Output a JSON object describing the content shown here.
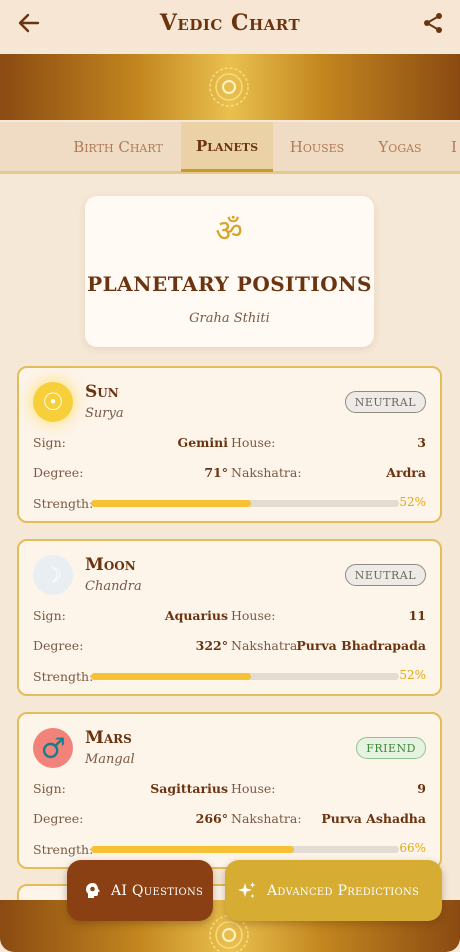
{
  "header": {
    "title": "Vedic Chart",
    "back_icon": "arrow-left-icon",
    "share_icon": "share-icon"
  },
  "tabs": [
    {
      "label": "Birth Chart",
      "active": false
    },
    {
      "label": "Planets",
      "active": true
    },
    {
      "label": "Houses",
      "active": false
    },
    {
      "label": "Yogas",
      "active": false
    },
    {
      "label": "I",
      "active": false
    }
  ],
  "hero": {
    "icon": "om-icon",
    "symbol": "ॐ",
    "title": "PLANETARY POSITIONS",
    "subtitle": "Graha Sthiti"
  },
  "labels": {
    "sign": "Sign:",
    "house": "House:",
    "degree": "Degree:",
    "nakshatra": "Nakshatra:",
    "strength": "Strength:"
  },
  "planets": [
    {
      "name": "Sun",
      "alt_name": "Surya",
      "icon": "sun-icon",
      "glyph": "☉",
      "status": "NEUTRAL",
      "sign": "Gemini",
      "house": "3",
      "degree": "71°",
      "nakshatra": "Ardra",
      "strength": 0.52,
      "strength_text": "52%"
    },
    {
      "name": "Moon",
      "alt_name": "Chandra",
      "icon": "moon-icon",
      "glyph": "☽",
      "status": "NEUTRAL",
      "sign": "Aquarius",
      "house": "11",
      "degree": "322°",
      "nakshatra": "Purva Bhadrapada",
      "strength": 0.52,
      "strength_text": "52%"
    },
    {
      "name": "Mars",
      "alt_name": "Mangal",
      "icon": "mars-icon",
      "glyph": "♂",
      "status": "FRIEND",
      "sign": "Sagittarius",
      "house": "9",
      "degree": "266°",
      "nakshatra": "Purva Ashadha",
      "strength": 0.66,
      "strength_text": "66%"
    }
  ],
  "actions": {
    "ai_questions": "AI Questions",
    "ai_icon": "brain-head-icon",
    "advanced_predictions": "Advanced Predictions",
    "advanced_icon": "sparkles-icon"
  },
  "colors": {
    "primary_brown": "#6b3410",
    "gold": "#d6ac33",
    "strength_fill": "#f6c134",
    "background": "#f6e8d7"
  }
}
